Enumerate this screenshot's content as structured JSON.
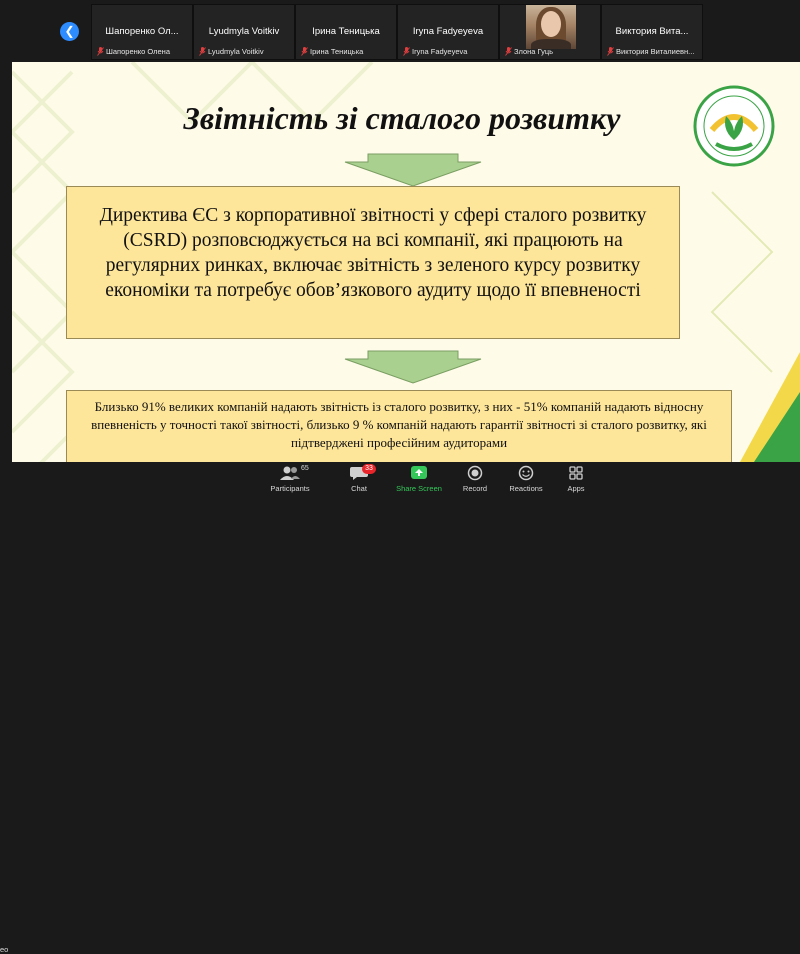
{
  "participants": [
    {
      "name": "Шапоренко  Ол...",
      "subname": "Шапоренко Олена",
      "muted": true
    },
    {
      "name": "Lyudmyla Voitkiv",
      "subname": "Lyudmyla Voitkiv",
      "muted": true
    },
    {
      "name": "Ірина Теницька",
      "subname": "Ірина Теницька",
      "muted": true
    },
    {
      "name": "Iryna Fadyeyeva",
      "subname": "Iryna Fadyeyeva",
      "muted": true
    },
    {
      "name": "",
      "subname": "Злона Гуць",
      "muted": true,
      "has_video": true
    },
    {
      "name": "Виктория  Вита...",
      "subname": "Виктория Виталиевн...",
      "muted": true
    }
  ],
  "slide": {
    "title": "Звітність зі сталого розвитку",
    "box1": "Директива ЄС з корпоративної звітності у сфері сталого розвитку (CSRD) розповсюджується на всі компанії, які працюють на регулярних ринках, включає звітність з зеленого курсу розвитку економіки та потребує обов’язкового аудиту щодо її впевненості",
    "box2": "Близько 91% великих компаній надають звітність із сталого розвитку, з них - 51% компаній надають відносну впевненість у точності такої звітності, близько 9 % компаній надають гарантії звітності зі сталого розвитку, які підтверджені професійним аудиторами",
    "colors": {
      "background": "#fffbe9",
      "box": "#fde59a",
      "arrow": "#a9d08e",
      "logo_green": "#3aa345",
      "logo_yellow": "#f2c230"
    }
  },
  "toolbar": {
    "edge_label": "eo",
    "participants": {
      "label": "Participants",
      "count": "65",
      "icon": "participants-icon"
    },
    "chat": {
      "label": "Chat",
      "badge": "33",
      "icon": "chat-icon"
    },
    "share": {
      "label": "Share Screen",
      "icon": "share-screen-icon",
      "color": "#35c759"
    },
    "record": {
      "label": "Record",
      "icon": "record-icon"
    },
    "reactions": {
      "label": "Reactions",
      "icon": "reactions-icon"
    },
    "apps": {
      "label": "Apps",
      "icon": "apps-icon"
    }
  }
}
